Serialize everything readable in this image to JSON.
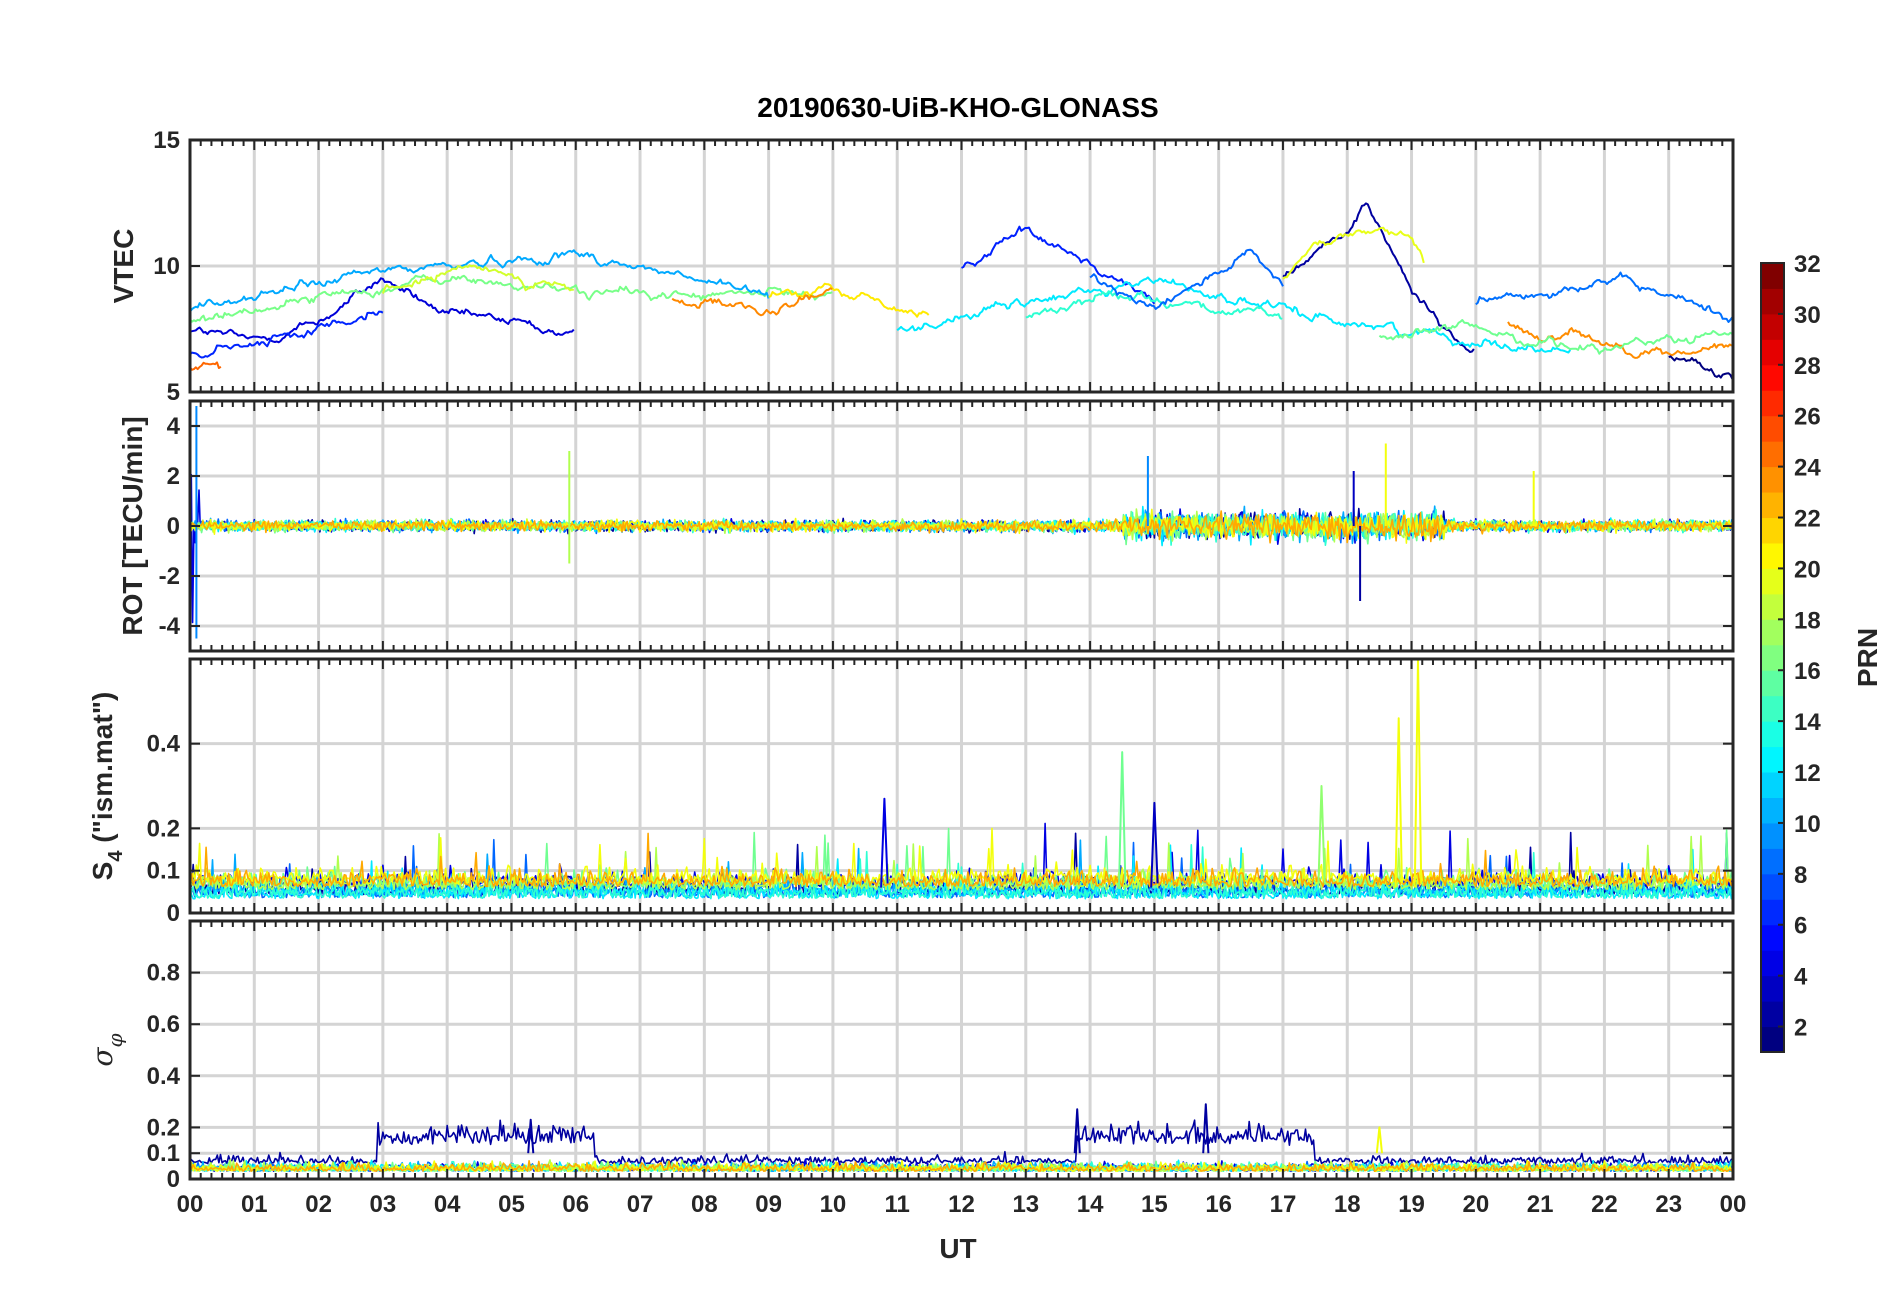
{
  "title": "20190630-UiB-KHO-GLONASS",
  "xlabel": "UT",
  "x_ticks": [
    "00",
    "01",
    "02",
    "03",
    "04",
    "05",
    "06",
    "07",
    "08",
    "09",
    "10",
    "11",
    "12",
    "13",
    "14",
    "15",
    "16",
    "17",
    "18",
    "19",
    "20",
    "21",
    "22",
    "23",
    "00"
  ],
  "panels": [
    {
      "id": "vtec",
      "ylabel": "VTEC",
      "ylim": [
        5,
        15
      ],
      "yticks": [
        5,
        10,
        15
      ]
    },
    {
      "id": "rot",
      "ylabel": "ROT [TECU/min]",
      "ylim": [
        -5,
        5
      ],
      "yticks": [
        -4,
        -2,
        0,
        2,
        4
      ]
    },
    {
      "id": "s4",
      "ylabel_main": "S",
      "ylabel_sub": "4",
      "ylabel_rest": " (\"ism.mat\")",
      "ylim": [
        0,
        0.6
      ],
      "yticks": [
        0,
        0.1,
        0.2,
        0.4
      ]
    },
    {
      "id": "sigma",
      "ylabel_main": "σ",
      "ylabel_sub": "φ",
      "ylim": [
        0,
        1
      ],
      "yticks": [
        0,
        0.1,
        0.2,
        0.4,
        0.6,
        0.8
      ]
    }
  ],
  "colorbar": {
    "label": "PRN",
    "range": [
      1,
      32
    ],
    "ticks": [
      "2",
      "4",
      "6",
      "8",
      "10",
      "12",
      "14",
      "16",
      "18",
      "20",
      "22",
      "24",
      "26",
      "28",
      "30",
      "32"
    ],
    "colormap": "jet"
  },
  "chart_data": [
    {
      "type": "line",
      "panel": "VTEC",
      "xlim": [
        0,
        24
      ],
      "ylim": [
        5,
        15
      ],
      "series": [
        {
          "prn": 3,
          "color": "#0000d8",
          "x": [
            0,
            1,
            2,
            3,
            4,
            5,
            6
          ],
          "y": [
            7.5,
            7.0,
            7.8,
            9.5,
            8.0,
            7.8,
            7.2
          ]
        },
        {
          "prn": 5,
          "color": "#0020ff",
          "x": [
            12,
            12.5,
            13,
            13.5,
            14,
            14.5,
            15
          ],
          "y": [
            9.8,
            10.8,
            11.5,
            11.0,
            10.2,
            9.5,
            8.5
          ]
        },
        {
          "prn": 2,
          "color": "#0000a0",
          "x": [
            17,
            17.5,
            18,
            18.3,
            18.6,
            19,
            19.5,
            20
          ],
          "y": [
            9.5,
            10.5,
            11.5,
            12.6,
            11.0,
            9.0,
            7.5,
            6.5
          ]
        },
        {
          "prn": 9,
          "color": "#0070ff",
          "x": [
            20,
            21,
            21.5,
            22,
            23,
            24
          ],
          "y": [
            8.5,
            9.0,
            9.3,
            9.5,
            8.8,
            8.0
          ]
        },
        {
          "prn": 18,
          "color": "#e8ff18",
          "x": [
            17,
            17.5,
            18,
            18.5,
            19,
            19.2
          ],
          "y": [
            9.5,
            10.8,
            11.2,
            11.5,
            11.0,
            10.0
          ]
        },
        {
          "prn": 23,
          "color": "#ff8c00",
          "x": [
            20.5,
            21,
            21.5,
            22,
            23,
            24
          ],
          "y": [
            7.8,
            7.2,
            7.5,
            7.0,
            6.5,
            6.8
          ]
        },
        {
          "prn": 15,
          "color": "#78ff88",
          "x": [
            0,
            2,
            4,
            6,
            8,
            10
          ],
          "y": [
            7.8,
            8.8,
            9.5,
            9.0,
            8.8,
            9.0
          ]
        }
      ]
    },
    {
      "type": "line",
      "panel": "ROT",
      "xlim": [
        0,
        24
      ],
      "ylim": [
        -5,
        5
      ],
      "note_values": "fluctuations around 0 TECU/min; spikes near 18.6 UT reaching about 3.3 and near 18.2 UT about -3.0"
    },
    {
      "type": "line",
      "panel": "S4",
      "xlim": [
        0,
        24
      ],
      "ylim": [
        0,
        0.6
      ],
      "peaks": [
        {
          "x": 19.1,
          "y": 0.6,
          "prn": 20
        },
        {
          "x": 18.8,
          "y": 0.46,
          "prn": 20
        },
        {
          "x": 14.5,
          "y": 0.38,
          "prn": 16
        },
        {
          "x": 17.6,
          "y": 0.3,
          "prn": 17
        },
        {
          "x": 10.8,
          "y": 0.27,
          "prn": 4
        },
        {
          "x": 15.0,
          "y": 0.26,
          "prn": 3
        }
      ]
    },
    {
      "type": "line",
      "panel": "sigma_phi",
      "xlim": [
        0,
        24
      ],
      "ylim": [
        0,
        1
      ],
      "peaks": [
        {
          "x": 15.8,
          "y": 0.29,
          "prn": 2
        },
        {
          "x": 13.8,
          "y": 0.27,
          "prn": 2
        },
        {
          "x": 5.3,
          "y": 0.23,
          "prn": 2
        },
        {
          "x": 18.5,
          "y": 0.2,
          "prn": 20
        }
      ]
    }
  ]
}
